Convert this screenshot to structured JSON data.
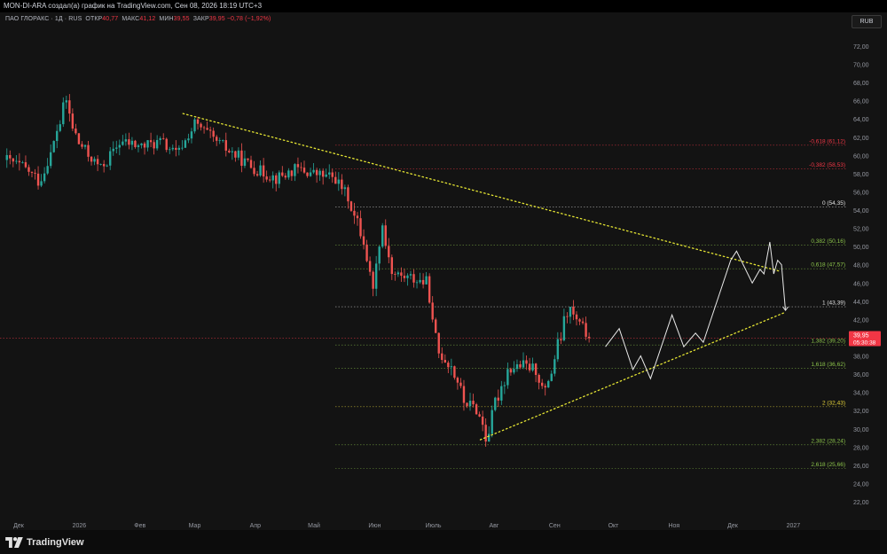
{
  "header": {
    "attribution": "MON-DI-ARA создал(а) график на TradingView.com, Сен 08, 2026 18:19 UTC+3"
  },
  "legend": {
    "symbol": "ПАО ГЛОРАКС · 1Д · RUS",
    "open_label": "ОТКР",
    "open_value": "40,77",
    "high_label": "МАКС",
    "high_value": "41,12",
    "low_label": "МИН",
    "low_value": "39,55",
    "close_label": "ЗАКР",
    "close_value": "39,95",
    "change": "−0,78 (−1,92%)"
  },
  "currency_button": "RUB",
  "price_badge": {
    "price": "39,95",
    "countdown": "05:30:38",
    "value": 39.95,
    "color": "#f23645"
  },
  "colors": {
    "up": "#26a69a",
    "down": "#ef5350",
    "fib_green": "#8bc34a",
    "fib_red": "#f23645",
    "fib_yellow": "#e8d63a",
    "trend_yellow": "#e6e633",
    "projection": "#e8e8e8",
    "axis_text": "#9598a1"
  },
  "brand": {
    "name": "TradingView"
  },
  "chart_data": {
    "type": "candlestick",
    "y_axis": {
      "range": [
        21,
        74
      ],
      "ticks": [
        "22,00",
        "24,00",
        "26,00",
        "28,00",
        "30,00",
        "32,00",
        "34,00",
        "36,00",
        "38,00",
        "40,00",
        "42,00",
        "44,00",
        "46,00",
        "48,00",
        "50,00",
        "52,00",
        "54,00",
        "56,00",
        "58,00",
        "60,00",
        "62,00",
        "64,00",
        "66,00",
        "68,00",
        "70,00",
        "72,00"
      ],
      "tick_values": [
        22,
        24,
        26,
        28,
        30,
        32,
        34,
        36,
        38,
        40,
        42,
        44,
        46,
        48,
        50,
        52,
        54,
        56,
        58,
        60,
        62,
        64,
        66,
        68,
        70,
        72
      ]
    },
    "x_axis": {
      "labels": [
        "Дек",
        "2026",
        "Фев",
        "Мар",
        "Апр",
        "Май",
        "Июн",
        "Июль",
        "Авг",
        "Сен",
        "Окт",
        "Ноя",
        "Дек",
        "2027"
      ],
      "dates": [
        "2025-12-01",
        "2026-01-01",
        "2026-02-01",
        "2026-03-01",
        "2026-04-01",
        "2026-05-01",
        "2026-06-01",
        "2026-07-01",
        "2026-08-01",
        "2026-09-01",
        "2026-10-01",
        "2026-11-01",
        "2026-12-01",
        "2027-01-01"
      ]
    },
    "price_path": [
      [
        "2025-11-25",
        59.5
      ],
      [
        "2025-12-05",
        58.5
      ],
      [
        "2025-12-12",
        57.0
      ],
      [
        "2025-12-20",
        62.0
      ],
      [
        "2025-12-25",
        66.0
      ],
      [
        "2025-12-31",
        61.5
      ],
      [
        "2026-01-12",
        58.5
      ],
      [
        "2026-01-22",
        61.5
      ],
      [
        "2026-02-02",
        61.0
      ],
      [
        "2026-02-12",
        61.5
      ],
      [
        "2026-02-20",
        60.0
      ],
      [
        "2026-03-01",
        63.5
      ],
      [
        "2026-03-12",
        61.5
      ],
      [
        "2026-03-22",
        60.0
      ],
      [
        "2026-04-01",
        58.5
      ],
      [
        "2026-04-12",
        57.5
      ],
      [
        "2026-04-22",
        58.5
      ],
      [
        "2026-05-01",
        58.0
      ],
      [
        "2026-05-12",
        57.5
      ],
      [
        "2026-05-18",
        55.5
      ],
      [
        "2026-05-25",
        51.5
      ],
      [
        "2026-06-01",
        45.0
      ],
      [
        "2026-06-04",
        53.5
      ],
      [
        "2026-06-10",
        47.0
      ],
      [
        "2026-06-20",
        46.5
      ],
      [
        "2026-06-28",
        46.0
      ],
      [
        "2026-07-03",
        38.5
      ],
      [
        "2026-07-10",
        37.0
      ],
      [
        "2026-07-17",
        33.0
      ],
      [
        "2026-07-24",
        32.0
      ],
      [
        "2026-07-28",
        29.0
      ],
      [
        "2026-08-02",
        33.0
      ],
      [
        "2026-08-08",
        36.5
      ],
      [
        "2026-08-15",
        37.0
      ],
      [
        "2026-08-22",
        36.5
      ],
      [
        "2026-08-27",
        34.0
      ],
      [
        "2026-08-31",
        37.0
      ],
      [
        "2026-09-04",
        40.0
      ],
      [
        "2026-09-08",
        43.5
      ],
      [
        "2026-09-13",
        41.5
      ],
      [
        "2026-09-20",
        39.95
      ]
    ],
    "fib_levels": [
      {
        "label": "-0,618 (61,12)",
        "value": 61.12,
        "color": "#f23645"
      },
      {
        "label": "-0,382 (58,53)",
        "value": 58.53,
        "color": "#f23645"
      },
      {
        "label": "0 (54,35)",
        "value": 54.35,
        "color": "#e0e0e0"
      },
      {
        "label": "0,382 (50,16)",
        "value": 50.16,
        "color": "#8bc34a"
      },
      {
        "label": "0,618 (47,57)",
        "value": 47.57,
        "color": "#8bc34a"
      },
      {
        "label": "1 (43,39)",
        "value": 43.39,
        "color": "#e0e0e0"
      },
      {
        "label": "1,382 (39,20)",
        "value": 39.2,
        "color": "#8bc34a"
      },
      {
        "label": "1,618 (36,62)",
        "value": 36.62,
        "color": "#8bc34a"
      },
      {
        "label": "2 (32,43)",
        "value": 32.43,
        "color": "#e8d63a"
      },
      {
        "label": "2,382 (28,24)",
        "value": 28.24,
        "color": "#8bc34a"
      },
      {
        "label": "2,618 (25,66)",
        "value": 25.66,
        "color": "#8bc34a"
      }
    ],
    "trendlines": [
      {
        "name": "upper",
        "start": [
          "2026-02-23",
          64.6
        ],
        "end": [
          "2026-12-25",
          47.3
        ]
      },
      {
        "name": "lower",
        "start": [
          "2026-07-25",
          28.8
        ],
        "end": [
          "2026-12-28",
          42.8
        ]
      }
    ],
    "projection_path": [
      [
        "2026-09-27",
        39.0
      ],
      [
        "2026-10-04",
        41.0
      ],
      [
        "2026-10-11",
        36.5
      ],
      [
        "2026-10-15",
        38.0
      ],
      [
        "2026-10-20",
        35.5
      ],
      [
        "2026-10-31",
        42.5
      ],
      [
        "2026-11-06",
        39.0
      ],
      [
        "2026-11-12",
        40.5
      ],
      [
        "2026-11-16",
        39.5
      ],
      [
        "2026-11-30",
        48.5
      ],
      [
        "2026-12-03",
        49.5
      ],
      [
        "2026-12-11",
        46.0
      ],
      [
        "2026-12-15",
        47.5
      ],
      [
        "2026-12-17",
        47.0
      ],
      [
        "2026-12-20",
        50.5
      ],
      [
        "2026-12-22",
        47.0
      ],
      [
        "2026-12-24",
        48.5
      ],
      [
        "2026-12-26",
        48.0
      ],
      [
        "2026-12-28",
        43.0
      ]
    ]
  }
}
